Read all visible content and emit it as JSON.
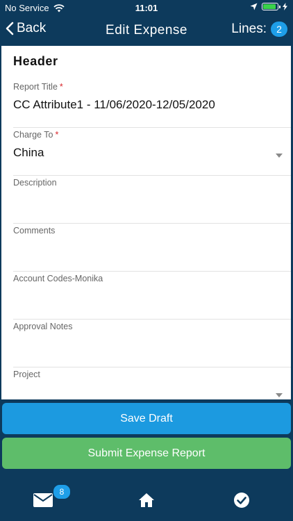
{
  "status": {
    "carrier": "No Service",
    "time": "11:01",
    "battery_level": 0.9,
    "battery_color": "#3ad34a"
  },
  "nav": {
    "back_label": "Back",
    "title": "Edit Expense",
    "lines_label": "Lines:",
    "lines_count": "2"
  },
  "form": {
    "section_title": "Header",
    "fields": [
      {
        "label": "Report Title",
        "required": "*",
        "value": "CC Attribute1 - 11/06/2020-12/05/2020"
      },
      {
        "label": "Charge To",
        "required": "*",
        "value": "China"
      },
      {
        "label": "Description",
        "value": ""
      },
      {
        "label": "Comments",
        "value": ""
      },
      {
        "label": "Account Codes-Monika",
        "value": ""
      },
      {
        "label": "Approval Notes",
        "value": ""
      },
      {
        "label": "Project",
        "value": ""
      }
    ]
  },
  "actions": {
    "save_label": "Save Draft",
    "submit_label": "Submit Expense Report"
  },
  "tabbar": {
    "mail_badge": "8",
    "icons": [
      "mail-icon",
      "home-icon",
      "check-circle-icon"
    ]
  },
  "colors": {
    "header_bg": "#0d3a5c",
    "accent_blue": "#1c9ae0",
    "accent_green": "#5ebd6a",
    "required_red": "#d9262b"
  }
}
